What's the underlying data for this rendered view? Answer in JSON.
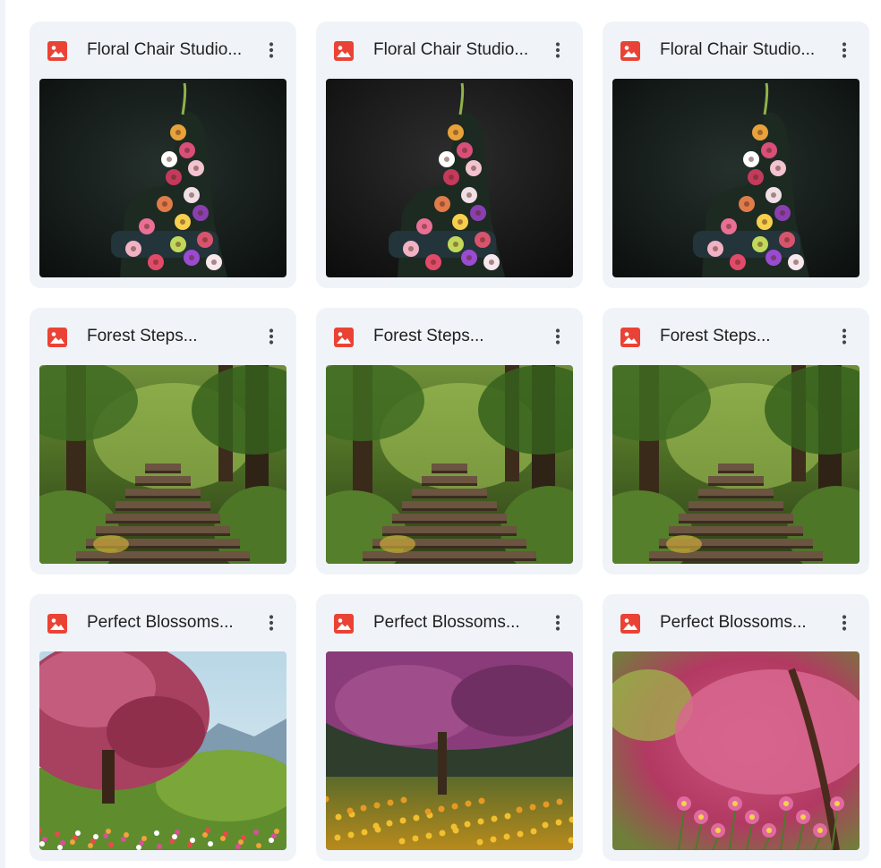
{
  "files": [
    {
      "name": "Floral Chair Studio...",
      "type_icon": "image-file-icon",
      "scene": "floral-chair-1",
      "more_icon": "more-vert-icon"
    },
    {
      "name": "Floral Chair Studio...",
      "type_icon": "image-file-icon",
      "scene": "floral-chair-2",
      "more_icon": "more-vert-icon"
    },
    {
      "name": "Floral Chair Studio...",
      "type_icon": "image-file-icon",
      "scene": "floral-chair-3",
      "more_icon": "more-vert-icon"
    },
    {
      "name": "Forest Steps...",
      "type_icon": "image-file-icon",
      "scene": "forest-steps-1",
      "more_icon": "more-vert-icon"
    },
    {
      "name": "Forest Steps...",
      "type_icon": "image-file-icon",
      "scene": "forest-steps-2",
      "more_icon": "more-vert-icon"
    },
    {
      "name": "Forest Steps...",
      "type_icon": "image-file-icon",
      "scene": "forest-steps-3",
      "more_icon": "more-vert-icon"
    },
    {
      "name": "Perfect Blossoms...",
      "type_icon": "image-file-icon",
      "scene": "blossoms-1",
      "more_icon": "more-vert-icon"
    },
    {
      "name": "Perfect Blossoms...",
      "type_icon": "image-file-icon",
      "scene": "blossoms-2",
      "more_icon": "more-vert-icon"
    },
    {
      "name": "Perfect Blossoms...",
      "type_icon": "image-file-icon",
      "scene": "blossoms-3",
      "more_icon": "more-vert-icon"
    }
  ],
  "colors": {
    "tile_background": "#f0f4f9",
    "image_icon": "#ea4335",
    "text": "#1f1f1f",
    "more_icon": "#444746"
  }
}
